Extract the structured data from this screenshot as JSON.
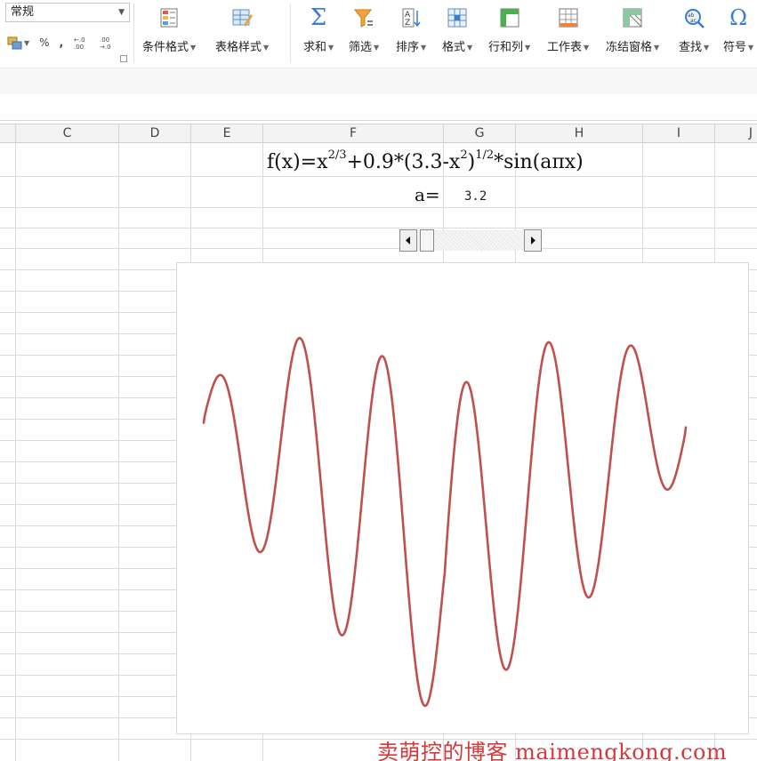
{
  "ribbon": {
    "number_format": "常规",
    "small_buttons": {
      "percent": "%",
      "comma": ","
    },
    "tools": [
      {
        "id": "cond-format",
        "label": "条件格式"
      },
      {
        "id": "table-style",
        "label": "表格样式"
      },
      {
        "id": "sum",
        "label": "求和"
      },
      {
        "id": "filter",
        "label": "筛选"
      },
      {
        "id": "sort",
        "label": "排序"
      },
      {
        "id": "format",
        "label": "格式"
      },
      {
        "id": "row-col",
        "label": "行和列"
      },
      {
        "id": "worksheet",
        "label": "工作表"
      },
      {
        "id": "freeze",
        "label": "冻结窗格"
      },
      {
        "id": "find",
        "label": "查找"
      },
      {
        "id": "symbol",
        "label": "符号"
      }
    ]
  },
  "columns": [
    "C",
    "D",
    "E",
    "F",
    "G",
    "H",
    "I",
    "J"
  ],
  "sheet": {
    "formula": {
      "p1": "f(x)=x",
      "s1": "2/3",
      "p2": "+0.9*(3.3-x",
      "s2": "2",
      "p3": ")",
      "s3": "1/2",
      "p4": "*sin(aπx)"
    },
    "a_label": "a=",
    "a_value": "3.2"
  },
  "scrollbar": {
    "value": 3.2
  },
  "chart_data": {
    "type": "line",
    "title": "",
    "xlabel": "",
    "ylabel": "",
    "series": [
      {
        "color": "#c0504d",
        "function": "x^(2/3)+0.9*(3.3-x^2)^(1/2)*sin(a*pi*x)",
        "a": 3.2
      }
    ],
    "x_range": [
      -1.816,
      1.816
    ],
    "y_range": [
      -1.55,
      3.05
    ],
    "grid": false,
    "legend": "none"
  },
  "watermark": "卖萌控的博客 maimengkong.com"
}
